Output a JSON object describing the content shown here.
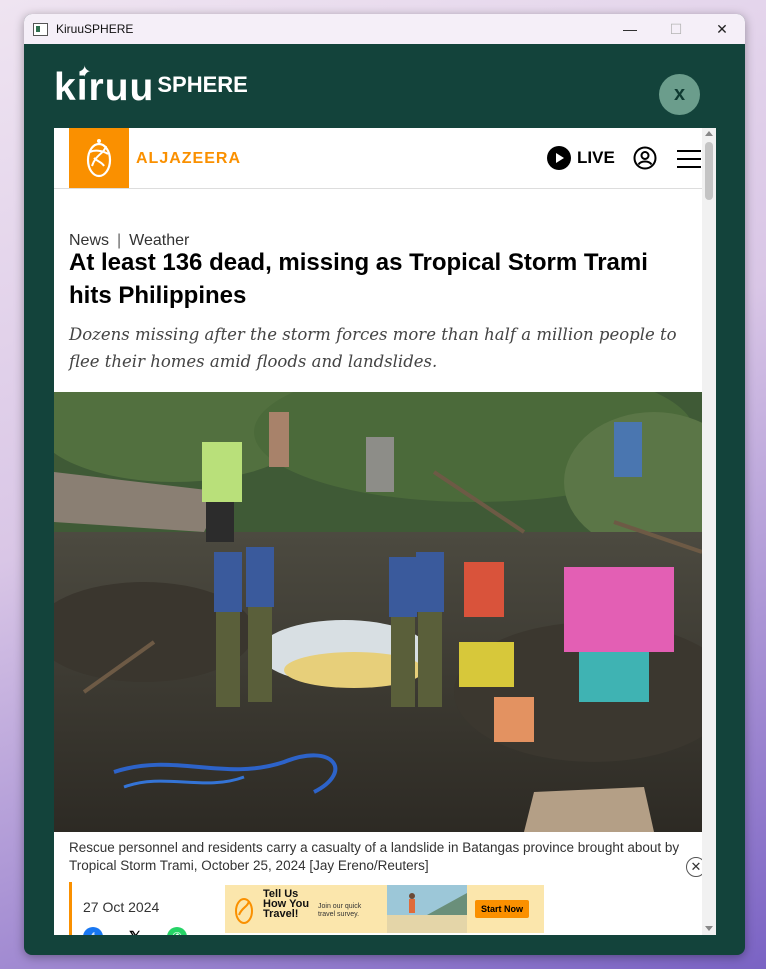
{
  "window": {
    "title": "KiruuSPHERE",
    "minimize": "—",
    "maximize": "☐",
    "close": "✕"
  },
  "brand": {
    "main": "kiruu",
    "sup": "SPHERE",
    "close_label": "x"
  },
  "site": {
    "name": "ALJAZEERA",
    "live_label": "LIVE"
  },
  "article": {
    "category": "News",
    "separator": "|",
    "section": "Weather",
    "headline": "At least 136 dead, missing as Tropical Storm Trami hits Philippines",
    "standfirst": "Dozens missing after the storm forces more than half a million people to flee their homes amid floods and landslides.",
    "caption": "Rescue personnel and residents carry a casualty of a landslide in Batangas province brought about by Tropical Storm Trami, October 25, 2024 [Jay Ereno/Reuters]",
    "date": "27 Oct 2024"
  },
  "ad": {
    "title_line1": "Tell Us",
    "title_line2": "How You",
    "title_line3": "Travel!",
    "sub": "Join our quick travel survey.",
    "cta": "Start Now",
    "close": "✕"
  },
  "colors": {
    "brand_bg": "#13433b",
    "aj_orange": "#fa9000",
    "close_btn": "#6b9d8c"
  },
  "icons": [
    "play-icon",
    "user-icon",
    "menu-icon",
    "facebook-icon",
    "x-icon",
    "whatsapp-icon"
  ]
}
